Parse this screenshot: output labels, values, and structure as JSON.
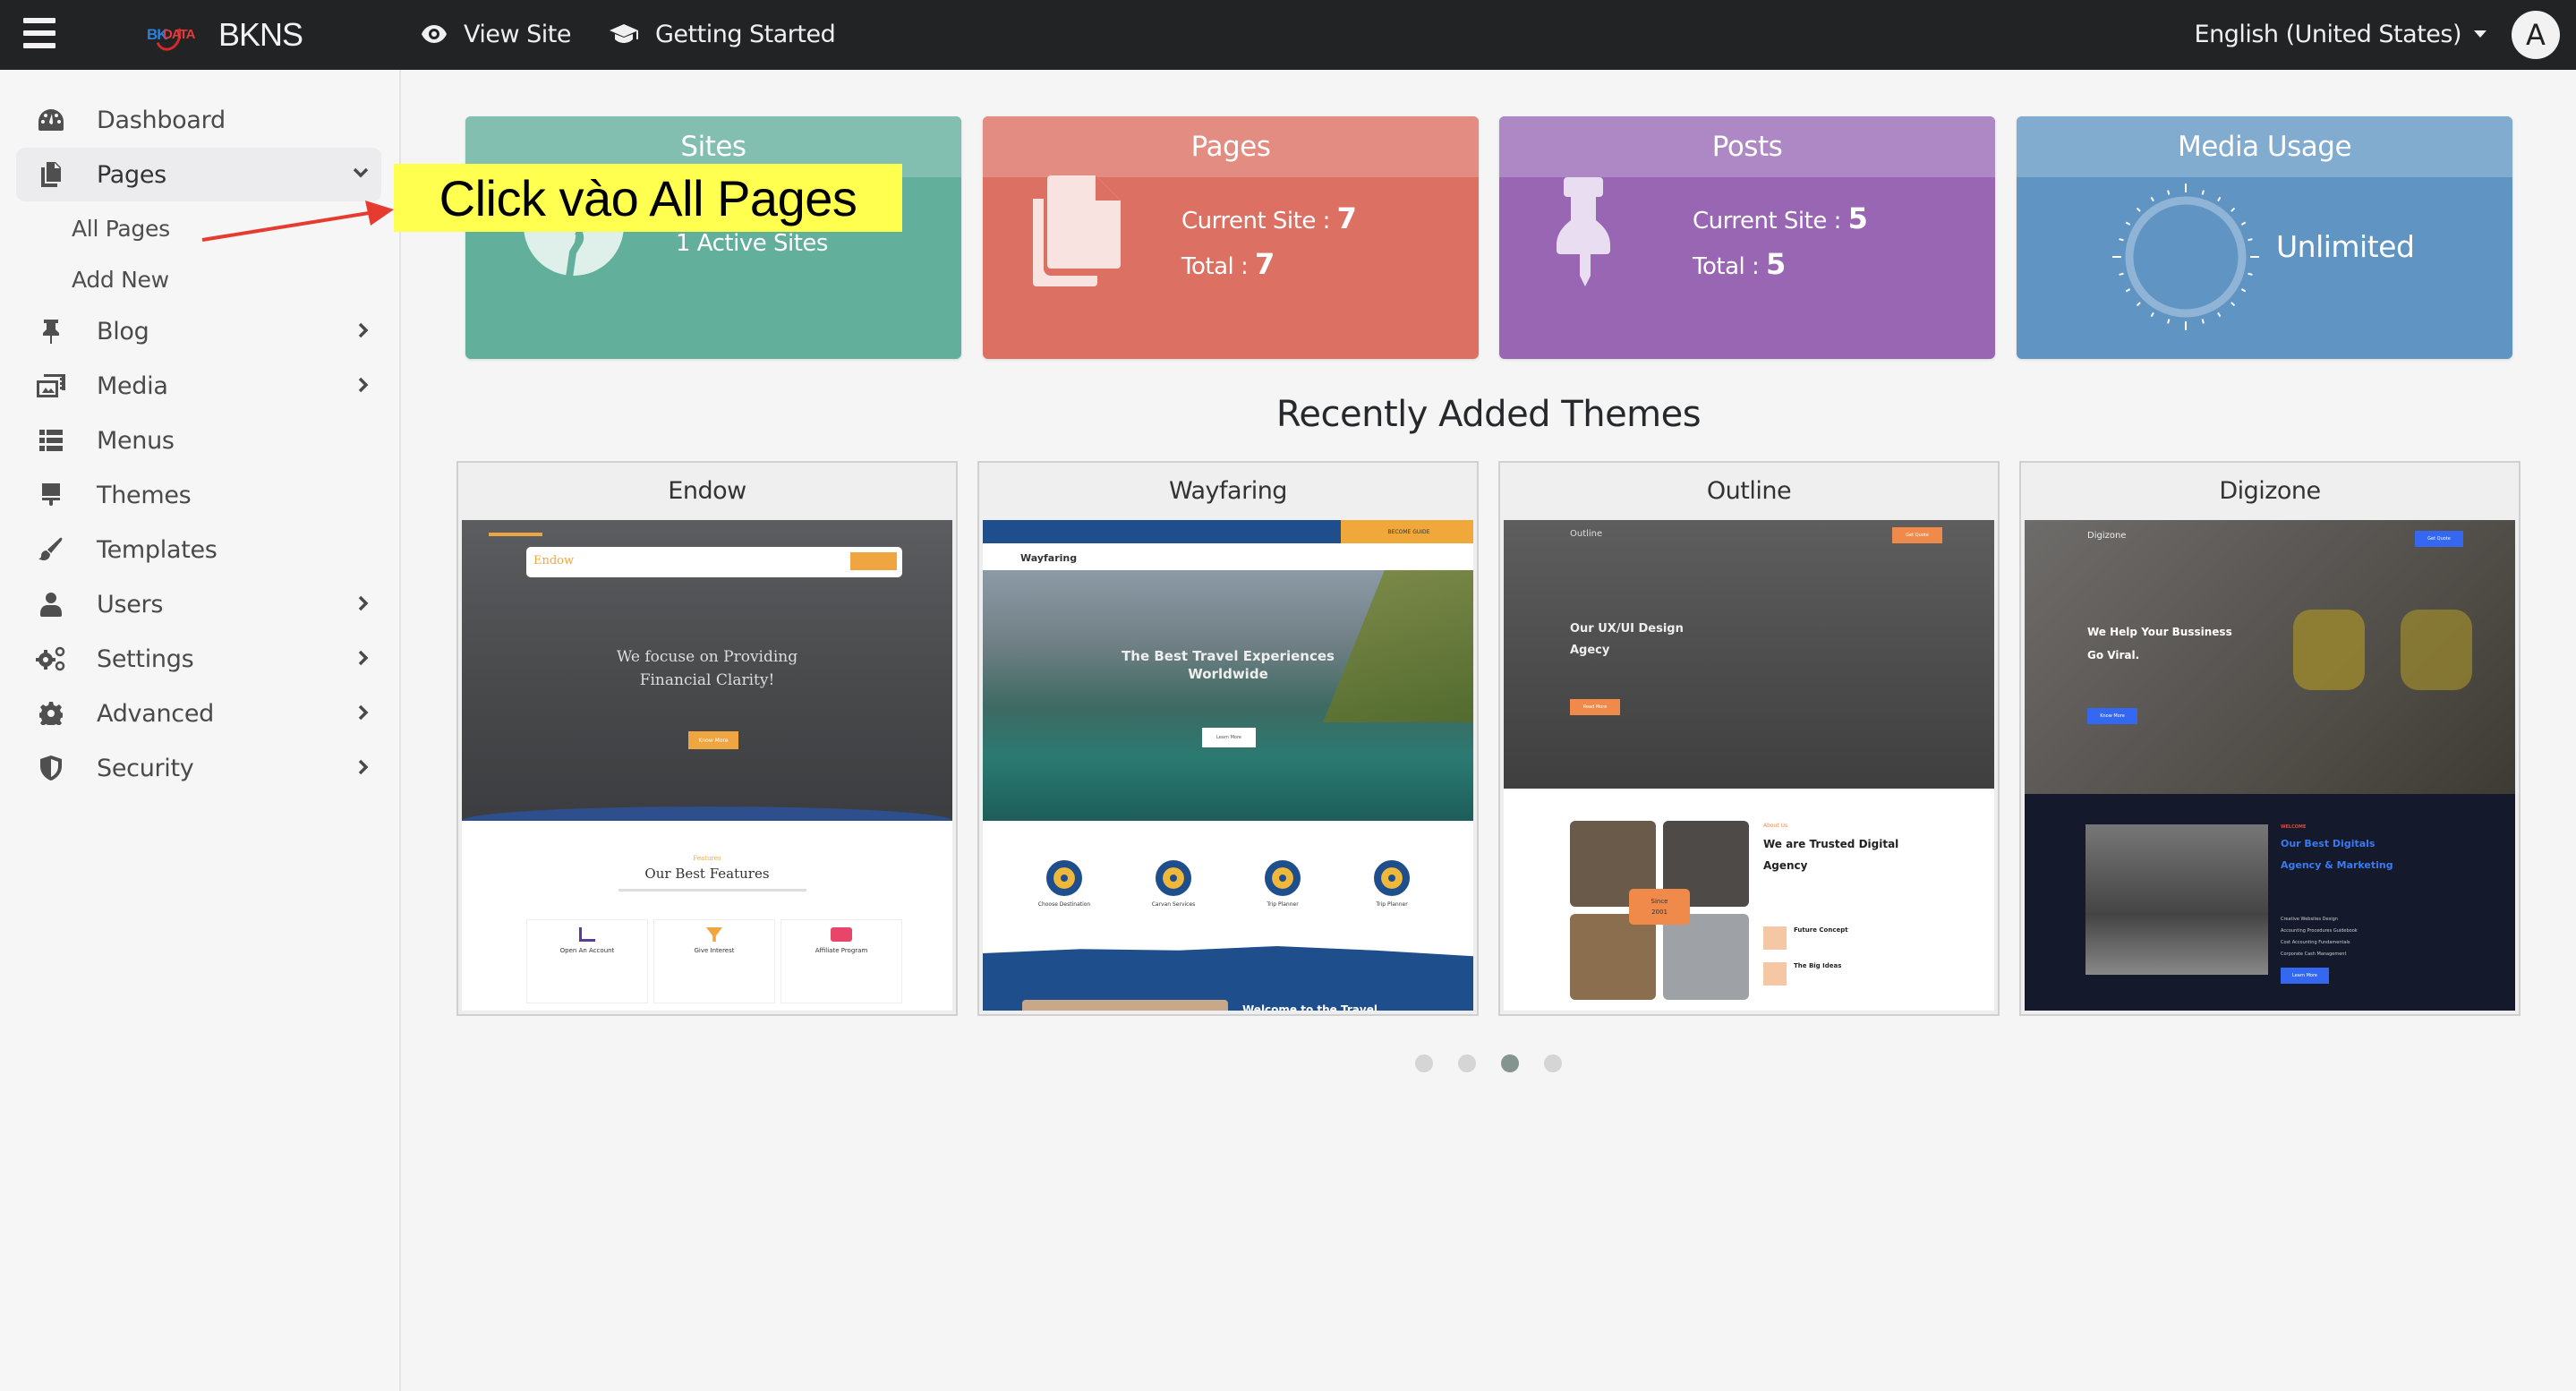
{
  "topbar": {
    "brand_mark_prefix": "BK",
    "brand_mark_suffix": "DATA",
    "brand_name": "BKNS",
    "links": [
      {
        "label": "View Site",
        "icon": "eye-icon"
      },
      {
        "label": "Getting Started",
        "icon": "graduation-cap-icon"
      }
    ],
    "language": "English (United States)",
    "avatar_initial": "A"
  },
  "sidebar": {
    "items": [
      {
        "label": "Dashboard",
        "icon": "dashboard-gauge-icon",
        "has_arrow": false
      },
      {
        "label": "Pages",
        "icon": "pages-copy-icon",
        "expanded": true,
        "active": true
      },
      {
        "label": "Blog",
        "icon": "pushpin-icon",
        "has_arrow": true
      },
      {
        "label": "Media",
        "icon": "photo-video-icon",
        "has_arrow": true
      },
      {
        "label": "Menus",
        "icon": "list-icon",
        "has_arrow": false
      },
      {
        "label": "Themes",
        "icon": "paint-roller-icon",
        "has_arrow": false
      },
      {
        "label": "Templates",
        "icon": "paint-brush-icon",
        "has_arrow": false
      },
      {
        "label": "Users",
        "icon": "user-icon",
        "has_arrow": true
      },
      {
        "label": "Settings",
        "icon": "cogs-icon",
        "has_arrow": true
      },
      {
        "label": "Advanced",
        "icon": "cog-icon",
        "has_arrow": true
      },
      {
        "label": "Security",
        "icon": "shield-icon",
        "has_arrow": true
      }
    ],
    "pages_submenu": [
      "All Pages",
      "Add New"
    ]
  },
  "stats": [
    {
      "title": "Sites",
      "lines": [
        "1 Active Sites"
      ],
      "icon": "globe-icon",
      "color_head": "#82bfb0",
      "color_body": "#62b09c"
    },
    {
      "title": "Pages",
      "current_label": "Current Site : ",
      "current_value": "7",
      "total_label": "Total : ",
      "total_value": "7",
      "icon": "file-copy-icon",
      "color_head": "#e38c82",
      "color_body": "#dc7163"
    },
    {
      "title": "Posts",
      "current_label": "Current Site : ",
      "current_value": "5",
      "total_label": "Total : ",
      "total_value": "5",
      "icon": "thumbtack-icon",
      "color_head": "#ad88c5",
      "color_body": "#9966b4"
    },
    {
      "title": "Media Usage",
      "value": "Unlimited",
      "icon": "circle-gauge-icon",
      "color_head": "#81abcf",
      "color_body": "#6094c2"
    }
  ],
  "themes_section": {
    "title": "Recently Added Themes",
    "themes": [
      {
        "name": "Endow",
        "thumb": {
          "brand": "Endow",
          "hero_line1": "We focuse on Providing",
          "hero_line2": "Financial Clarity!",
          "cta": "Know More",
          "section_kicker": "Features",
          "section_title": "Our Best Features",
          "features": [
            "Open An Account",
            "Give Interest",
            "Affiliate Program"
          ]
        }
      },
      {
        "name": "Wayfaring",
        "thumb": {
          "brand": "Wayfaring",
          "top_cta": "BECOME GUIDE",
          "hero_line1": "The Best Travel Experiences",
          "hero_line2": "Worldwide",
          "cta": "Learn More",
          "features": [
            "Choose Destination",
            "Carvan Services",
            "Trip Planner",
            "Trip Planner"
          ],
          "footer_text": "Welcome to the Travel"
        }
      },
      {
        "name": "Outline",
        "thumb": {
          "brand": "Outline",
          "hero_line1": "Our UX/UI Design",
          "hero_line2": "Agecy",
          "cta": "Read More",
          "nav_cta": "Get Quote",
          "about_kicker": "About Us",
          "about_title_1": "We are Trusted Digital",
          "about_title_2": "Agency",
          "badge_line1": "Since",
          "badge_line2": "2001",
          "features": [
            "Future Concept",
            "The Big Ideas"
          ]
        }
      },
      {
        "name": "Digizone",
        "thumb": {
          "brand": "Digizone",
          "nav_cta": "Get Quote",
          "hero_line1": "We Help Your Bussiness",
          "hero_line2": "Go Viral.",
          "cta": "Know More",
          "kicker": "WELCOME",
          "title_1": "Our Best Digitals",
          "title_2": "Agency & Marketing",
          "bullets": [
            "Creative Websites Design",
            "Accounting Procedures Guidebook",
            "Cost Accounting Fundamentals",
            "Corporate Cash Management"
          ],
          "cta2": "Learn More"
        }
      }
    ],
    "carousel": {
      "pages": 4,
      "active_index": 2
    }
  },
  "annotation": {
    "callout_text": "Click vào All Pages",
    "arrow_color": "#e63b2e",
    "callout_color": "#ffff4f"
  }
}
